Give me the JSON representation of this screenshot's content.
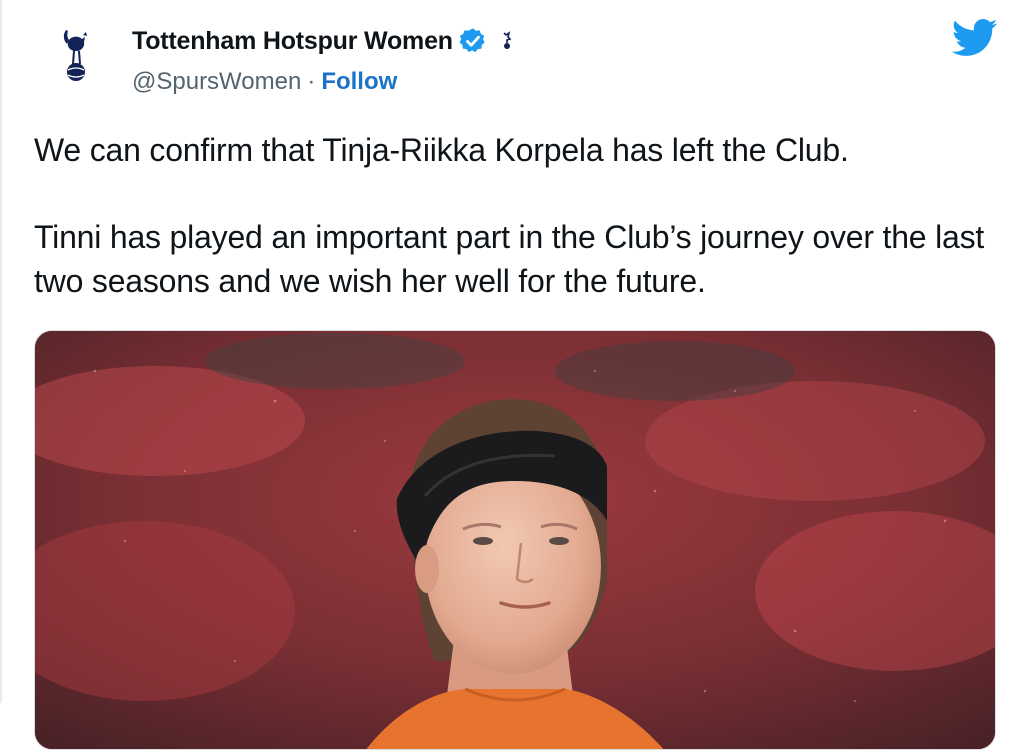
{
  "tweet": {
    "author": {
      "display_name": "Tottenham Hotspur Women",
      "handle": "@SpursWomen",
      "separator": "·",
      "follow_label": "Follow",
      "verified": true,
      "avatar_icon": "spurs-cockerel-icon"
    },
    "platform_icon": "twitter-bird-icon",
    "paragraphs": [
      "We can confirm that Tinja-Riikka Korpela has left the Club.",
      "Tinni has played an important part in the Club’s journey over the last two seasons and we wish her well for the future."
    ],
    "media": {
      "type": "photo"
    }
  },
  "colors": {
    "follow": "#1b73c8",
    "verified": "#1d9bf0",
    "twitter_blue": "#1d9bf0",
    "text": "#0f1419",
    "secondary_text": "#536471"
  }
}
